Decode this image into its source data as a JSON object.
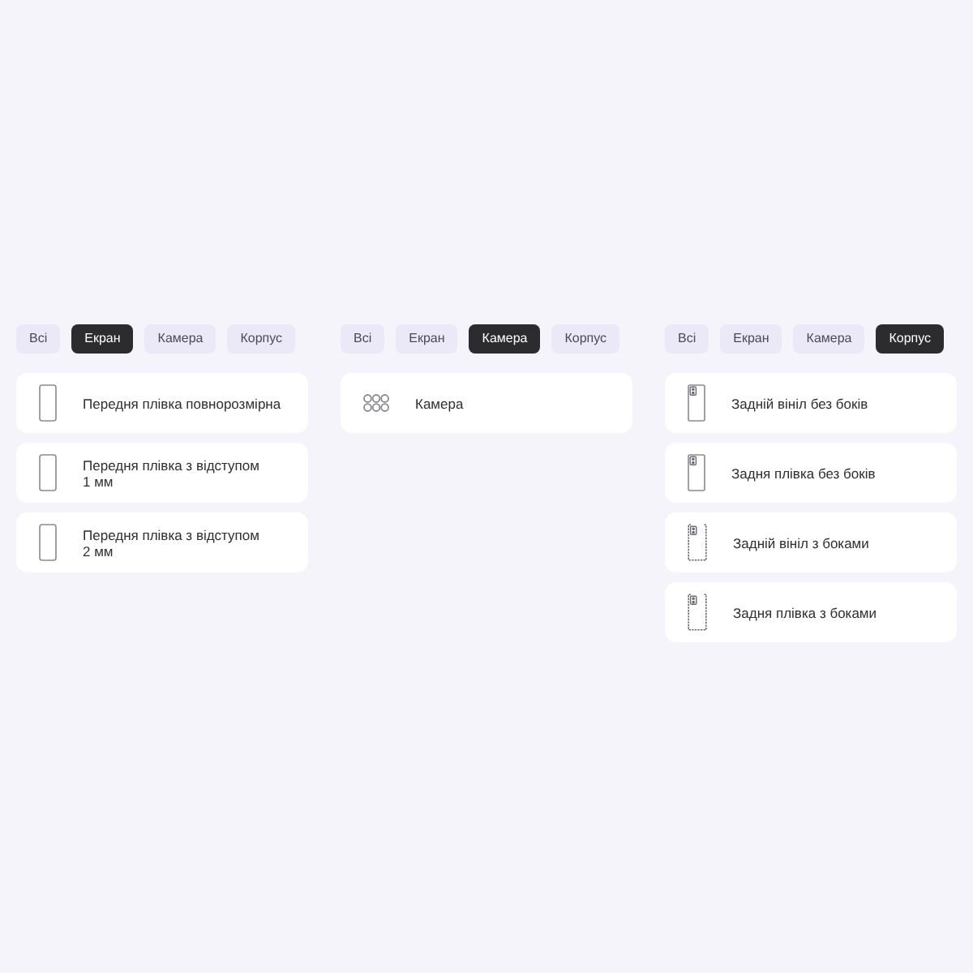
{
  "panels": [
    {
      "tabs": [
        {
          "label": "Всі",
          "selected": false
        },
        {
          "label": "Екран",
          "selected": true
        },
        {
          "label": "Камера",
          "selected": false
        },
        {
          "label": "Корпус",
          "selected": false
        }
      ],
      "items": [
        {
          "kind": "front",
          "title": "Передня плівка повнорозмірна"
        },
        {
          "kind": "front",
          "title": "Передня плівка з відступом 1 мм"
        },
        {
          "kind": "front",
          "title": "Передня плівка з відступом 2 мм"
        }
      ]
    },
    {
      "tabs": [
        {
          "label": "Всі",
          "selected": false
        },
        {
          "label": "Екран",
          "selected": false
        },
        {
          "label": "Камера",
          "selected": true
        },
        {
          "label": "Корпус",
          "selected": false
        }
      ],
      "items": [
        {
          "kind": "camera",
          "title": "Камера"
        }
      ]
    },
    {
      "tabs": [
        {
          "label": "Всі",
          "selected": false
        },
        {
          "label": "Екран",
          "selected": false
        },
        {
          "label": "Камера",
          "selected": false
        },
        {
          "label": "Корпус",
          "selected": true
        }
      ],
      "items": [
        {
          "kind": "back",
          "title": "Задній вініл без боків"
        },
        {
          "kind": "back",
          "title": "Задня плівка без боків"
        },
        {
          "kind": "back-sides",
          "title": "Задній вініл з боками"
        },
        {
          "kind": "back-sides",
          "title": "Задня плівка з боками"
        }
      ]
    }
  ]
}
